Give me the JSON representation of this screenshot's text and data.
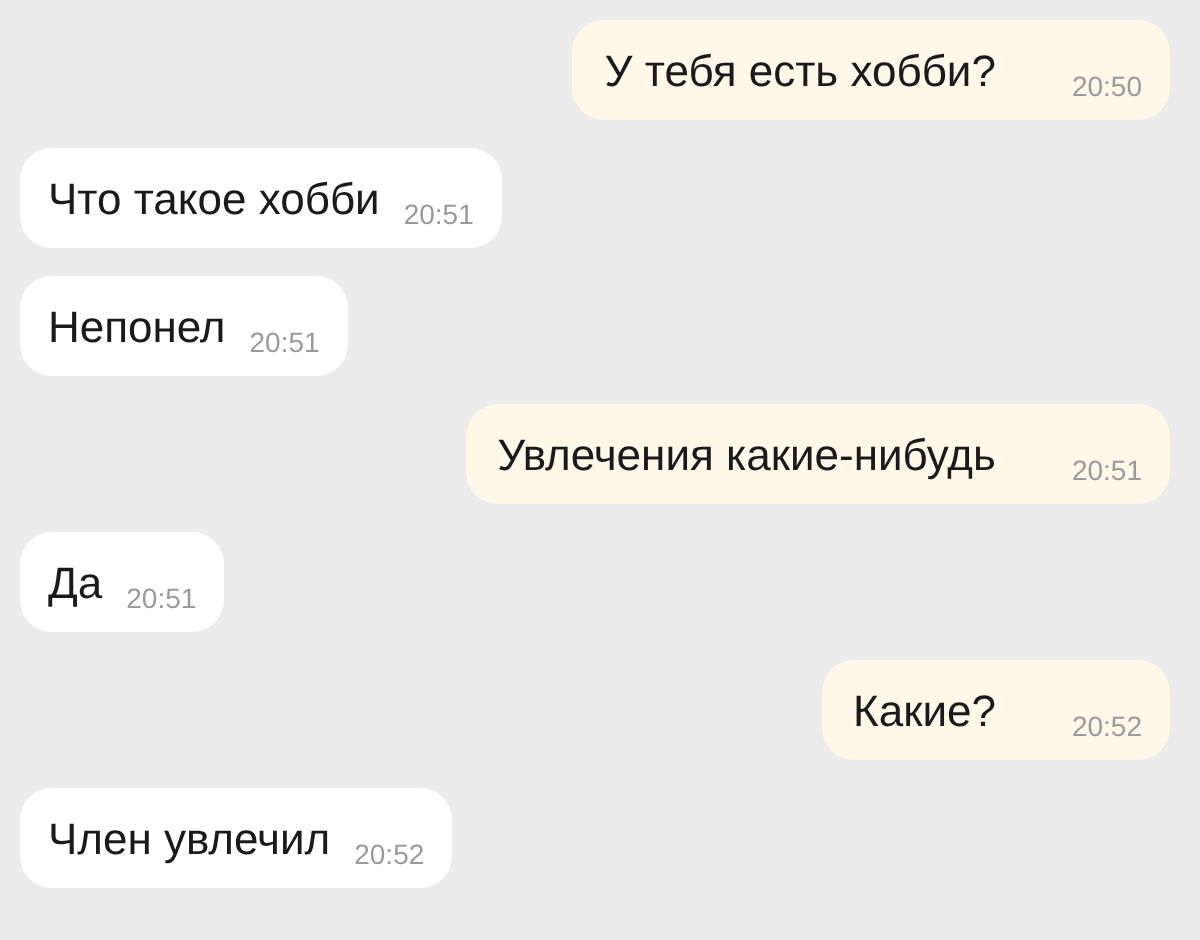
{
  "messages": [
    {
      "kind": "outgoing",
      "text": "У тебя есть хобби?",
      "time": "20:50"
    },
    {
      "kind": "incoming",
      "text": "Что такое хобби",
      "time": "20:51"
    },
    {
      "kind": "incoming",
      "text": "Непонел",
      "time": "20:51"
    },
    {
      "kind": "outgoing",
      "text": "Увлечения какие-нибудь",
      "time": "20:51"
    },
    {
      "kind": "incoming",
      "text": "Да",
      "time": "20:51"
    },
    {
      "kind": "outgoing",
      "text": "Какие?",
      "time": "20:52"
    },
    {
      "kind": "incoming",
      "text": "Член увлечил",
      "time": "20:52"
    }
  ]
}
